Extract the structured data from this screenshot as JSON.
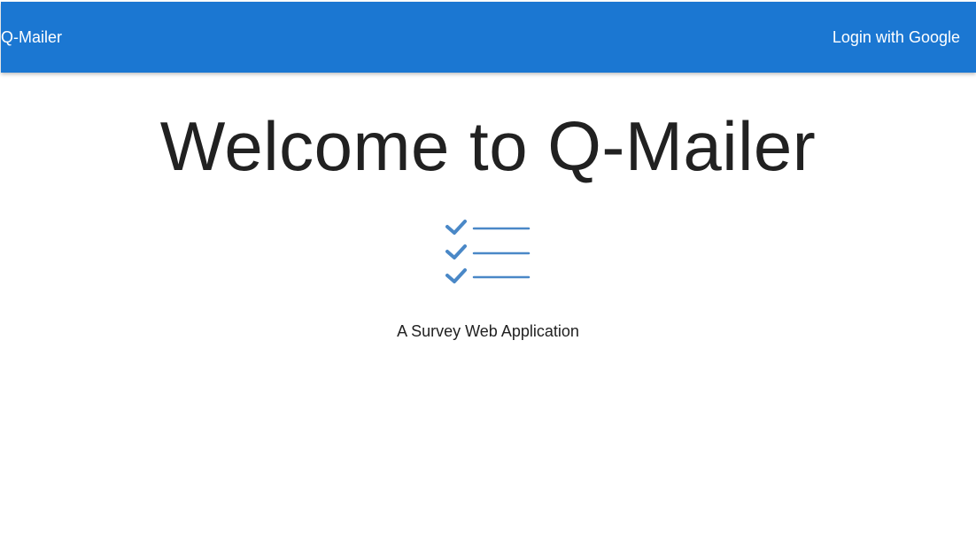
{
  "header": {
    "brand": "Q-Mailer",
    "login_label": "Login with Google"
  },
  "hero": {
    "title": "Welcome to Q-Mailer",
    "icon": "checklist-icon",
    "tagline": "A Survey Web Application"
  },
  "colors": {
    "navbar": "#1b77d2",
    "icon": "#4a88c7",
    "text": "#212121"
  }
}
